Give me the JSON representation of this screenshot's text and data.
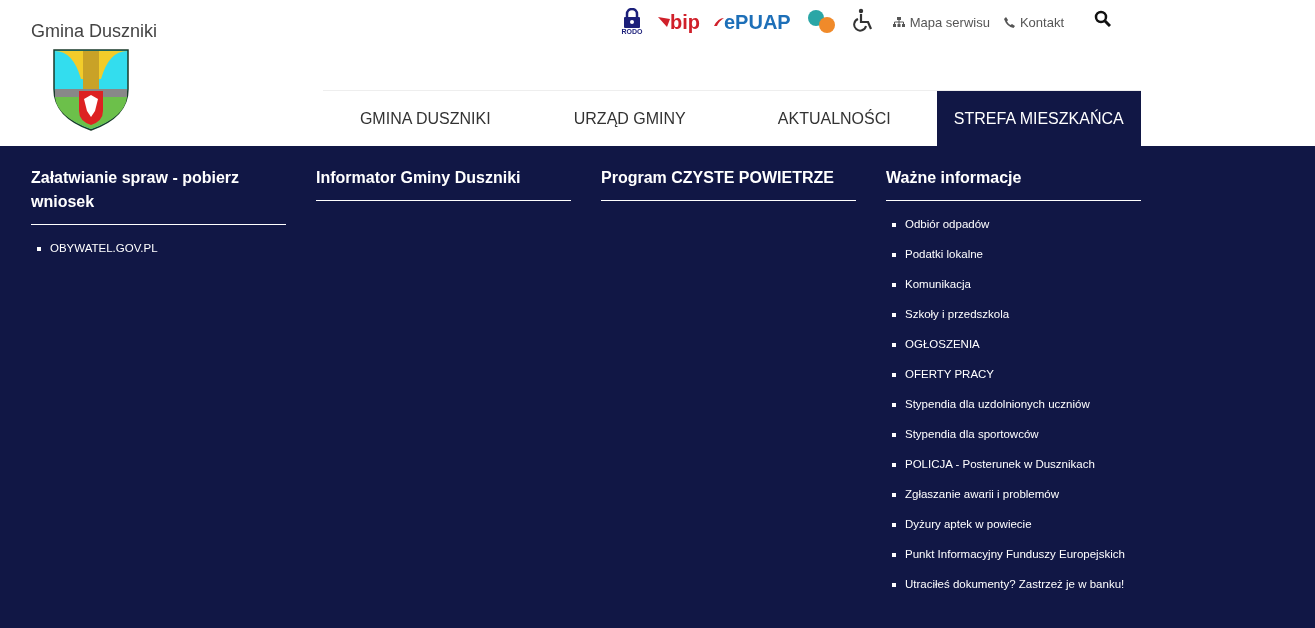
{
  "site_title": "Gmina Duszniki",
  "top_links": {
    "rodo": "RODO",
    "bip": "bip",
    "epuap": "ePUAP",
    "sitemap": "Mapa serwisu",
    "contact": "Kontakt"
  },
  "nav": [
    {
      "label": "GMINA DUSZNIKI",
      "selected": false
    },
    {
      "label": "URZĄD GMINY",
      "selected": false
    },
    {
      "label": "AKTUALNOŚCI",
      "selected": false
    },
    {
      "label": "STREFA MIESZKAŃCA",
      "selected": true
    }
  ],
  "columns": [
    {
      "heading": "Załatwianie spraw - pobierz wniosek",
      "items": [
        "OBYWATEL.GOV.PL"
      ]
    },
    {
      "heading": "Informator Gminy Duszniki"
    },
    {
      "heading": "Program CZYSTE POWIETRZE"
    },
    {
      "heading": "Ważne informacje",
      "items": [
        "Odbiór odpadów",
        "Podatki lokalne",
        "Komunikacja",
        "Szkoły i przedszkola",
        "OGŁOSZENIA",
        "OFERTY PRACY",
        "Stypendia dla uzdolnionych uczniów",
        "Stypendia dla sportowców",
        "POLICJA - Posterunek w Dusznikach",
        "Zgłaszanie awarii i problemów",
        "Dyżury aptek w powiecie",
        "Punkt Informacyjny Funduszy Europejskich",
        "Utraciłeś dokumenty? Zastrzeż je w banku!"
      ]
    }
  ]
}
